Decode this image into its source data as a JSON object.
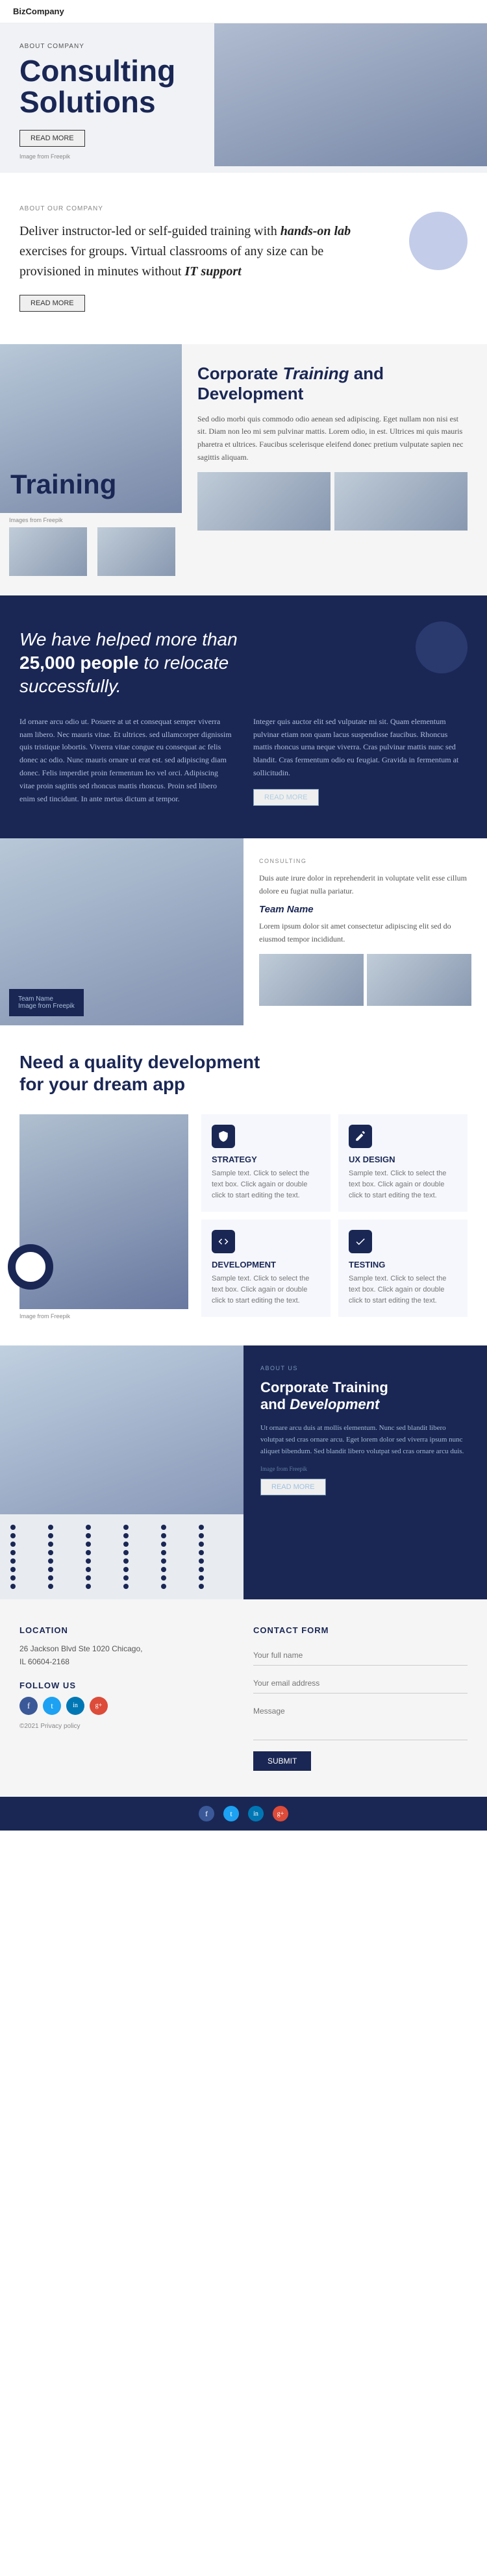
{
  "nav": {
    "logo": "BizCompany",
    "hamburger_aria": "open menu"
  },
  "hero": {
    "label": "ABOUT COMPANY",
    "title": "Consulting\nSolutions",
    "btn": "READ MORE",
    "caption": "Image from Freepik"
  },
  "deliver": {
    "label": "ABOUT OUR COMPANY",
    "text_before": "Deliver instructor-led or self-guided training with ",
    "text_italic": "hands-on lab",
    "text_mid": " exercises for groups. Virtual classrooms of any size can be provisioned in minutes without ",
    "text_italic2": "IT support",
    "btn": "READ MORE"
  },
  "training": {
    "big_label": "Training",
    "caption": "Images from Freepik",
    "right_heading_normal": "Corporate ",
    "right_heading_italic": "Training",
    "right_heading_end": " and Development",
    "right_p1": "Sed odio morbi quis commodo odio aenean sed adipiscing. Eget nullam non nisi est sit. Diam non leo mi sem pulvinar mattis. Lorem odio, in est. Ultrices mi quis mauris pharetra et ultrices. Faucibus scelerisque eleifend donec pretium vulputate sapien nec sagittis aliquam."
  },
  "helped": {
    "heading": "We have helped more than 25,000 people to relocate successfully.",
    "col1": "Id ornare arcu odio ut. Posuere at ut et consequat semper viverra nam libero. Nec mauris vitae. Et ultrices. sed ullamcorper dignissim quis tristique lobortis. Viverra vitae congue eu consequat ac felis donec ac odio. Nunc mauris ornare ut erat est. sed adipiscing diam donec. Felis imperdiet proin fermentum leo vel orci. Adipiscing vitae proin sagittis sed rhoncus mattis rhoncus. Proin sed libero enim sed tincidunt. In ante metus dictum at tempor.",
    "col2": "Integer quis auctor elit sed vulputate mi sit. Quam elementum pulvinar etiam non quam lacus suspendisse faucibus. Rhoncus mattis rhoncus urna neque viverra. Cras pulvinar mattis nunc sed blandit. Cras fermentum odio eu feugiat. Gravida in fermentum at sollicitudin.",
    "btn": "READ MORE"
  },
  "consulting": {
    "label": "CONSULTING",
    "overlay_p": "Team Name\nImage from Freepik",
    "body": "Duis aute irure dolor in reprehenderit in voluptate velit esse cillum dolore eu fugiat nulla pariatur.",
    "subheading": "Team Name",
    "p2": "Lorem ipsum dolor sit amet consectetur adipiscing elit sed do eiusmod tempor incididunt."
  },
  "app": {
    "heading": "Need a quality development\nfor your dream app",
    "caption": "Image from Freepik",
    "cards": [
      {
        "icon": "shield",
        "title": "STRATEGY",
        "text": "Sample text. Click to select the text box. Click again or double click to start editing the text."
      },
      {
        "icon": "pencil",
        "title": "UX DESIGN",
        "text": "Sample text. Click to select the text box. Click again or double click to start editing the text."
      },
      {
        "icon": "code",
        "title": "DEVELOPMENT",
        "text": "Sample text. Click to select the text box. Click again or double click to start editing the text."
      },
      {
        "icon": "check",
        "title": "TESTING",
        "text": "Sample text. Click to select the text box. Click again or double click to start editing the text."
      }
    ]
  },
  "about": {
    "label": "ABOUT US",
    "heading_normal": "Corporate Training\nand ",
    "heading_italic": "Development",
    "body": "Ut ornare arcu duis at mollis elementum. Nunc sed blandit libero volutpat sed cras ornare arcu. Eget lorem dolor sed viverra ipsum nunc aliquet bibendum. Sed blandit libero volutpat sed cras ornare arcu duis.",
    "caption": "Image from Freepik",
    "btn": "READ MORE"
  },
  "footer": {
    "location_heading": "LOCATION",
    "address": "26 Jackson Blvd Ste 1020 Chicago,\nIL 60604-2168",
    "follow_heading": "FOLLOW US",
    "policy": "©2021 Privacy policy",
    "contact_heading": "contact form",
    "fields": {
      "name_placeholder": "Your full name",
      "email_placeholder": "Your email address",
      "message_placeholder": "Message",
      "submit": "SUBMIT"
    },
    "social": [
      {
        "name": "facebook",
        "symbol": "f"
      },
      {
        "name": "twitter",
        "symbol": "t"
      },
      {
        "name": "linkedin",
        "symbol": "in"
      },
      {
        "name": "google-plus",
        "symbol": "g+"
      }
    ]
  }
}
